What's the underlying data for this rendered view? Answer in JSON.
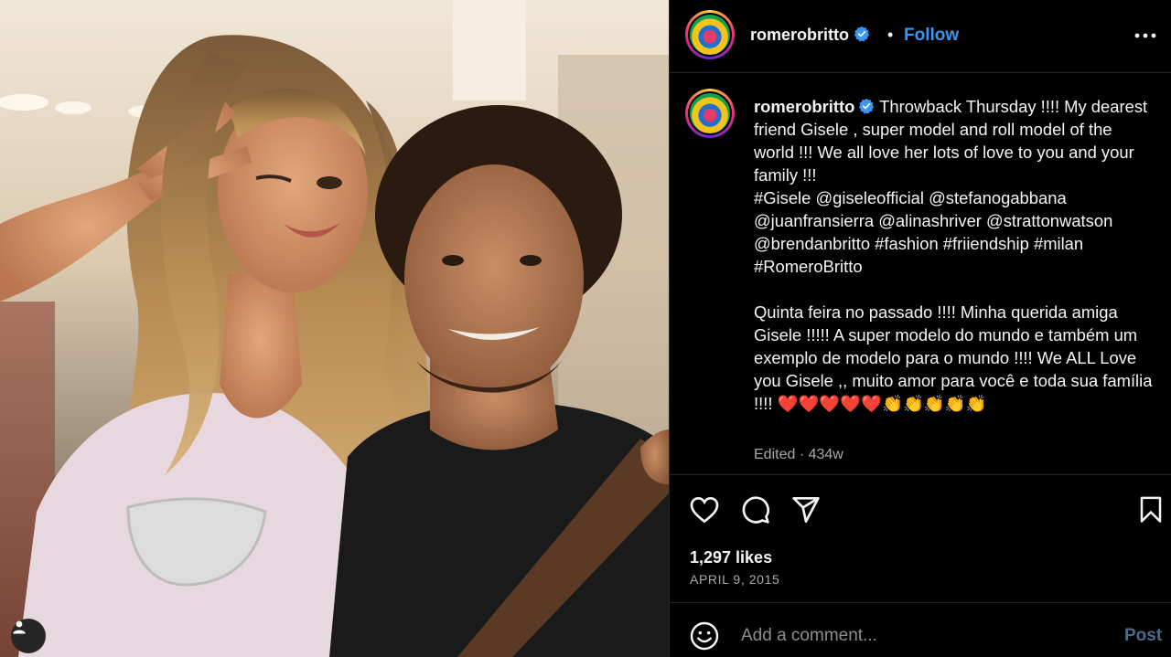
{
  "colors": {
    "accent": "#3897f0",
    "verified": "#3897f0",
    "muted": "#a8a8a8",
    "background": "#000000"
  },
  "photo": {
    "user_tag_icon": "user-icon"
  },
  "header": {
    "username": "romerobritto",
    "verified_icon": "verified-badge-icon",
    "separator": "•",
    "follow_label": "Follow",
    "more_icon": "more-options-icon"
  },
  "caption": {
    "username": "romerobritto",
    "text": " Throwback Thursday !!!! My dearest friend Gisele , super model and roll model of the world !!! We all love her lots of love to you and your family !!!\n#Gisele @giseleofficial @stefanogabbana @juanfransierra @alinashriver @strattonwatson @brendanbritto #fashion #friiendship #milan #RomeroBritto\n\nQuinta feira no passado !!!! Minha querida amiga Gisele !!!!! A super modelo do mundo e também um exemplo de modelo para o mundo !!!! We ALL Love you Gisele ,, muito amor para você e toda sua família !!!! ❤️❤️❤️❤️❤️👏👏👏👏👏",
    "meta": "Edited · 434w"
  },
  "actions": {
    "icons": [
      "heart-icon",
      "comment-icon",
      "share-icon",
      "save-icon"
    ],
    "likes": "1,297 likes",
    "date": "APRIL 9, 2015"
  },
  "comment": {
    "emoji_icon": "emoji-icon",
    "placeholder": "Add a comment...",
    "post_label": "Post"
  }
}
